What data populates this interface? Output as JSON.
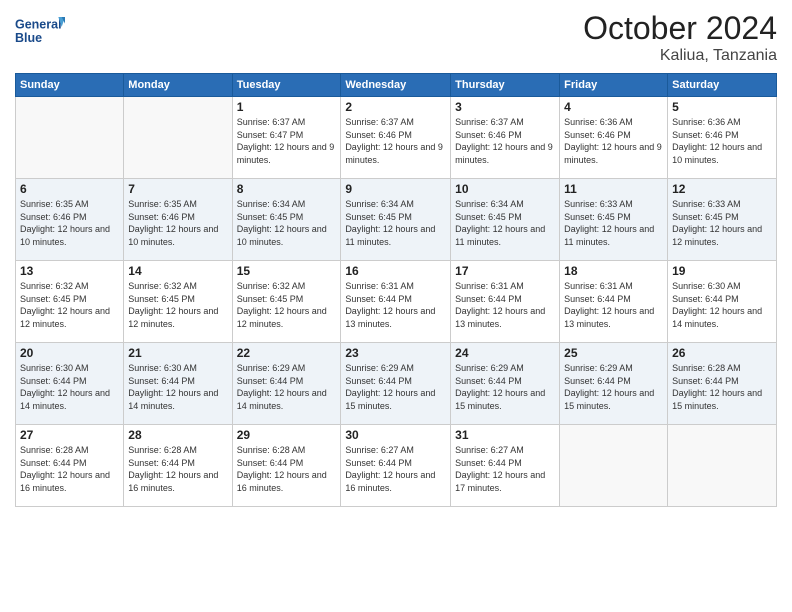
{
  "logo": {
    "line1": "General",
    "line2": "Blue"
  },
  "header": {
    "month": "October 2024",
    "location": "Kaliua, Tanzania"
  },
  "weekdays": [
    "Sunday",
    "Monday",
    "Tuesday",
    "Wednesday",
    "Thursday",
    "Friday",
    "Saturday"
  ],
  "weeks": [
    [
      {
        "day": "",
        "info": ""
      },
      {
        "day": "",
        "info": ""
      },
      {
        "day": "1",
        "info": "Sunrise: 6:37 AM\nSunset: 6:47 PM\nDaylight: 12 hours and 9 minutes."
      },
      {
        "day": "2",
        "info": "Sunrise: 6:37 AM\nSunset: 6:46 PM\nDaylight: 12 hours and 9 minutes."
      },
      {
        "day": "3",
        "info": "Sunrise: 6:37 AM\nSunset: 6:46 PM\nDaylight: 12 hours and 9 minutes."
      },
      {
        "day": "4",
        "info": "Sunrise: 6:36 AM\nSunset: 6:46 PM\nDaylight: 12 hours and 9 minutes."
      },
      {
        "day": "5",
        "info": "Sunrise: 6:36 AM\nSunset: 6:46 PM\nDaylight: 12 hours and 10 minutes."
      }
    ],
    [
      {
        "day": "6",
        "info": "Sunrise: 6:35 AM\nSunset: 6:46 PM\nDaylight: 12 hours and 10 minutes."
      },
      {
        "day": "7",
        "info": "Sunrise: 6:35 AM\nSunset: 6:46 PM\nDaylight: 12 hours and 10 minutes."
      },
      {
        "day": "8",
        "info": "Sunrise: 6:34 AM\nSunset: 6:45 PM\nDaylight: 12 hours and 10 minutes."
      },
      {
        "day": "9",
        "info": "Sunrise: 6:34 AM\nSunset: 6:45 PM\nDaylight: 12 hours and 11 minutes."
      },
      {
        "day": "10",
        "info": "Sunrise: 6:34 AM\nSunset: 6:45 PM\nDaylight: 12 hours and 11 minutes."
      },
      {
        "day": "11",
        "info": "Sunrise: 6:33 AM\nSunset: 6:45 PM\nDaylight: 12 hours and 11 minutes."
      },
      {
        "day": "12",
        "info": "Sunrise: 6:33 AM\nSunset: 6:45 PM\nDaylight: 12 hours and 12 minutes."
      }
    ],
    [
      {
        "day": "13",
        "info": "Sunrise: 6:32 AM\nSunset: 6:45 PM\nDaylight: 12 hours and 12 minutes."
      },
      {
        "day": "14",
        "info": "Sunrise: 6:32 AM\nSunset: 6:45 PM\nDaylight: 12 hours and 12 minutes."
      },
      {
        "day": "15",
        "info": "Sunrise: 6:32 AM\nSunset: 6:45 PM\nDaylight: 12 hours and 12 minutes."
      },
      {
        "day": "16",
        "info": "Sunrise: 6:31 AM\nSunset: 6:44 PM\nDaylight: 12 hours and 13 minutes."
      },
      {
        "day": "17",
        "info": "Sunrise: 6:31 AM\nSunset: 6:44 PM\nDaylight: 12 hours and 13 minutes."
      },
      {
        "day": "18",
        "info": "Sunrise: 6:31 AM\nSunset: 6:44 PM\nDaylight: 12 hours and 13 minutes."
      },
      {
        "day": "19",
        "info": "Sunrise: 6:30 AM\nSunset: 6:44 PM\nDaylight: 12 hours and 14 minutes."
      }
    ],
    [
      {
        "day": "20",
        "info": "Sunrise: 6:30 AM\nSunset: 6:44 PM\nDaylight: 12 hours and 14 minutes."
      },
      {
        "day": "21",
        "info": "Sunrise: 6:30 AM\nSunset: 6:44 PM\nDaylight: 12 hours and 14 minutes."
      },
      {
        "day": "22",
        "info": "Sunrise: 6:29 AM\nSunset: 6:44 PM\nDaylight: 12 hours and 14 minutes."
      },
      {
        "day": "23",
        "info": "Sunrise: 6:29 AM\nSunset: 6:44 PM\nDaylight: 12 hours and 15 minutes."
      },
      {
        "day": "24",
        "info": "Sunrise: 6:29 AM\nSunset: 6:44 PM\nDaylight: 12 hours and 15 minutes."
      },
      {
        "day": "25",
        "info": "Sunrise: 6:29 AM\nSunset: 6:44 PM\nDaylight: 12 hours and 15 minutes."
      },
      {
        "day": "26",
        "info": "Sunrise: 6:28 AM\nSunset: 6:44 PM\nDaylight: 12 hours and 15 minutes."
      }
    ],
    [
      {
        "day": "27",
        "info": "Sunrise: 6:28 AM\nSunset: 6:44 PM\nDaylight: 12 hours and 16 minutes."
      },
      {
        "day": "28",
        "info": "Sunrise: 6:28 AM\nSunset: 6:44 PM\nDaylight: 12 hours and 16 minutes."
      },
      {
        "day": "29",
        "info": "Sunrise: 6:28 AM\nSunset: 6:44 PM\nDaylight: 12 hours and 16 minutes."
      },
      {
        "day": "30",
        "info": "Sunrise: 6:27 AM\nSunset: 6:44 PM\nDaylight: 12 hours and 16 minutes."
      },
      {
        "day": "31",
        "info": "Sunrise: 6:27 AM\nSunset: 6:44 PM\nDaylight: 12 hours and 17 minutes."
      },
      {
        "day": "",
        "info": ""
      },
      {
        "day": "",
        "info": ""
      }
    ]
  ]
}
